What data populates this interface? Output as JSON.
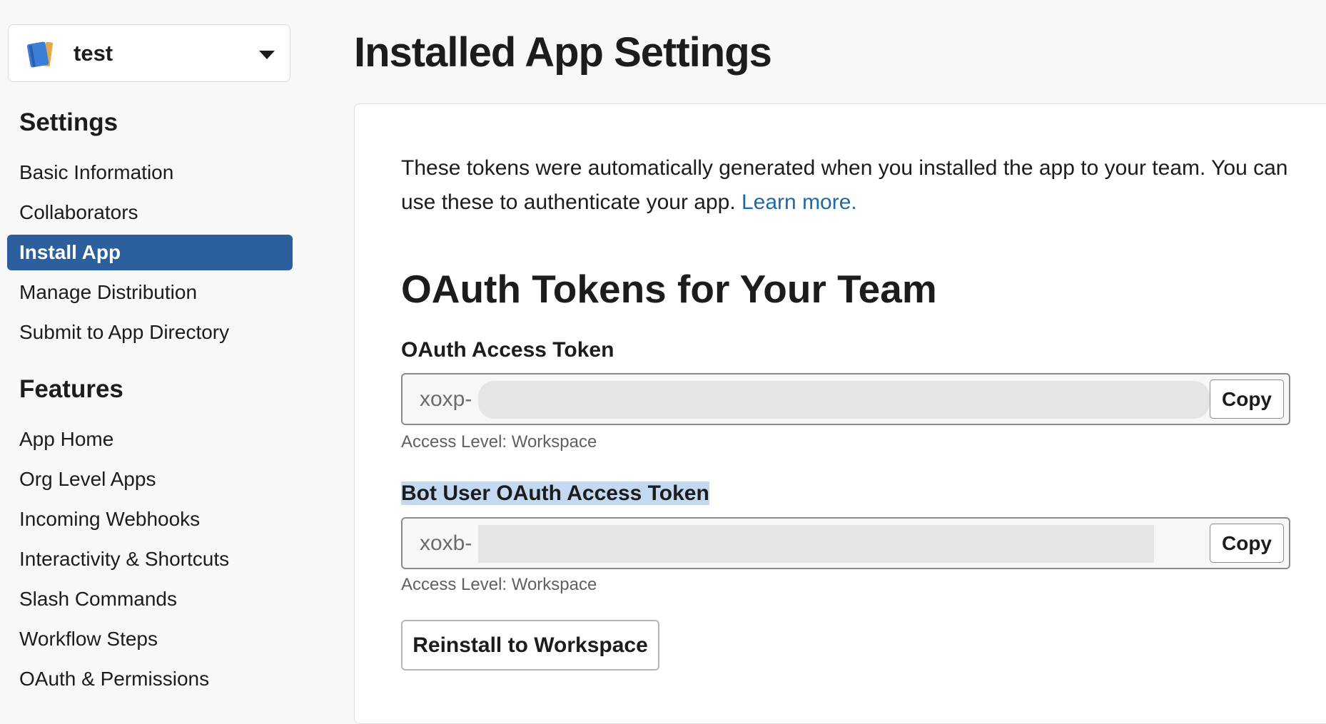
{
  "app_switcher": {
    "name": "test",
    "icon": "notebook-icon"
  },
  "sidebar": {
    "settings_title": "Settings",
    "settings_items": [
      {
        "label": "Basic Information"
      },
      {
        "label": "Collaborators"
      },
      {
        "label": "Install App",
        "active": true
      },
      {
        "label": "Manage Distribution"
      },
      {
        "label": "Submit to App Directory"
      }
    ],
    "features_title": "Features",
    "features_items": [
      {
        "label": "App Home"
      },
      {
        "label": "Org Level Apps"
      },
      {
        "label": "Incoming Webhooks"
      },
      {
        "label": "Interactivity & Shortcuts"
      },
      {
        "label": "Slash Commands"
      },
      {
        "label": "Workflow Steps"
      },
      {
        "label": "OAuth & Permissions"
      }
    ]
  },
  "main": {
    "page_title": "Installed App Settings",
    "intro_text": "These tokens were automatically generated when you installed the app to your team. You can use these to authenticate your app. ",
    "learn_more": "Learn more.",
    "section_title": "OAuth Tokens for Your Team",
    "oauth_token": {
      "label": "OAuth Access Token",
      "prefix": "xoxp-",
      "copy_label": "Copy",
      "access_level": "Access Level: Workspace"
    },
    "bot_token": {
      "label": "Bot User OAuth Access Token",
      "prefix": "xoxb-",
      "copy_label": "Copy",
      "access_level": "Access Level: Workspace"
    },
    "reinstall_label": "Reinstall to Workspace"
  },
  "colors": {
    "accent": "#2c5f9e",
    "link": "#1d6aa8",
    "selection": "#c3d9f2"
  }
}
